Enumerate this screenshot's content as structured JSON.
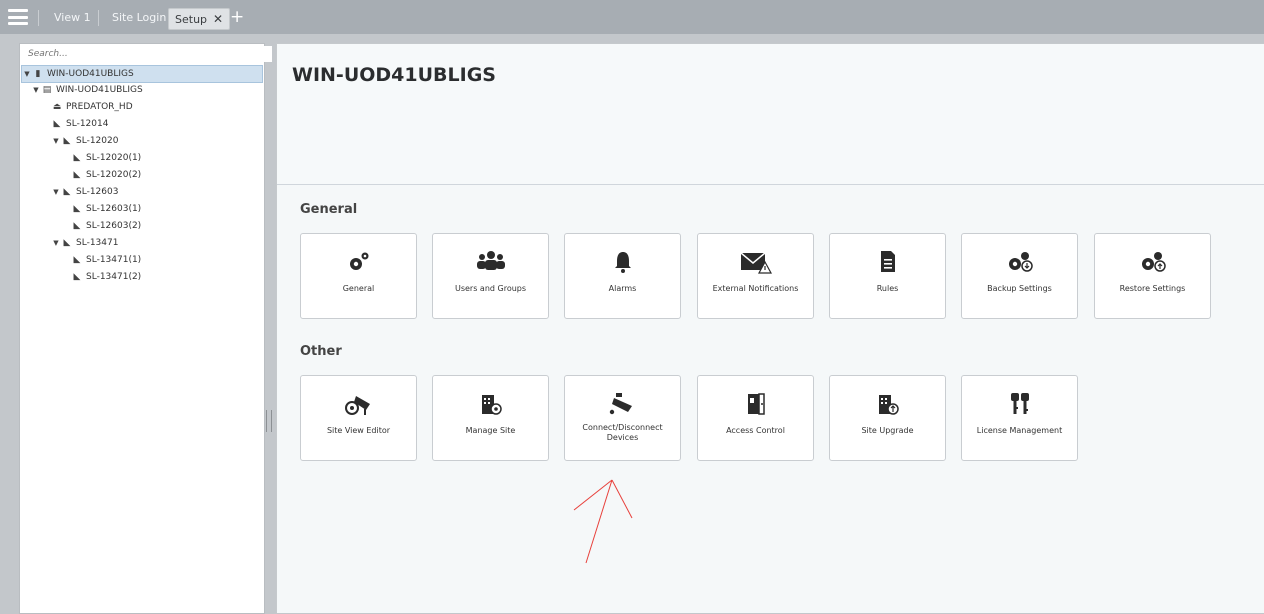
{
  "tabs": {
    "menu_icon": "hamburger-icon",
    "items": [
      {
        "label": "View 1"
      },
      {
        "label": "Site Login"
      },
      {
        "label": "Setup",
        "active": true,
        "close_glyph": "✕"
      }
    ],
    "add_glyph": "+"
  },
  "tree": {
    "search_placeholder": "Search...",
    "items": [
      {
        "label": "WIN-UOD41UBLIGS",
        "icon": "site-icon",
        "expanded": true,
        "selected": true
      },
      {
        "label": "WIN-UOD41UBLIGS",
        "icon": "server-icon",
        "expanded": true
      },
      {
        "label": "PREDATOR_HD",
        "icon": "dome-camera-icon"
      },
      {
        "label": "SL-12014",
        "icon": "camera-icon"
      },
      {
        "label": "SL-12020",
        "icon": "camera-icon",
        "expanded": true
      },
      {
        "label": "SL-12020(1)",
        "icon": "camera-icon"
      },
      {
        "label": "SL-12020(2)",
        "icon": "camera-icon"
      },
      {
        "label": "SL-12603",
        "icon": "camera-icon",
        "expanded": true
      },
      {
        "label": "SL-12603(1)",
        "icon": "camera-icon"
      },
      {
        "label": "SL-12603(2)",
        "icon": "camera-icon"
      },
      {
        "label": "SL-13471",
        "icon": "camera-icon",
        "expanded": true
      },
      {
        "label": "SL-13471(1)",
        "icon": "camera-icon"
      },
      {
        "label": "SL-13471(2)",
        "icon": "camera-icon"
      }
    ]
  },
  "main": {
    "title": "WIN-UOD41UBLIGS",
    "sections": [
      {
        "title": "General",
        "cards": [
          {
            "label": "General",
            "icon": "gears-icon"
          },
          {
            "label": "Users and Groups",
            "icon": "users-icon"
          },
          {
            "label": "Alarms",
            "icon": "bell-icon"
          },
          {
            "label": "External Notifications",
            "icon": "envelope-warning-icon"
          },
          {
            "label": "Rules",
            "icon": "document-icon"
          },
          {
            "label": "Backup Settings",
            "icon": "gears-backup-icon"
          },
          {
            "label": "Restore Settings",
            "icon": "gears-restore-icon"
          }
        ]
      },
      {
        "title": "Other",
        "cards": [
          {
            "label": "Site View Editor",
            "icon": "camera-view-icon"
          },
          {
            "label": "Manage Site",
            "icon": "building-gear-icon"
          },
          {
            "label": "Connect/Disconnect Devices",
            "icon": "camera-connect-icon"
          },
          {
            "label": "Access Control",
            "icon": "door-icon"
          },
          {
            "label": "Site Upgrade",
            "icon": "building-upgrade-icon"
          },
          {
            "label": "License Management",
            "icon": "keys-icon"
          }
        ]
      }
    ]
  },
  "annotation": {
    "color": "#e8413c",
    "type": "arrow"
  }
}
